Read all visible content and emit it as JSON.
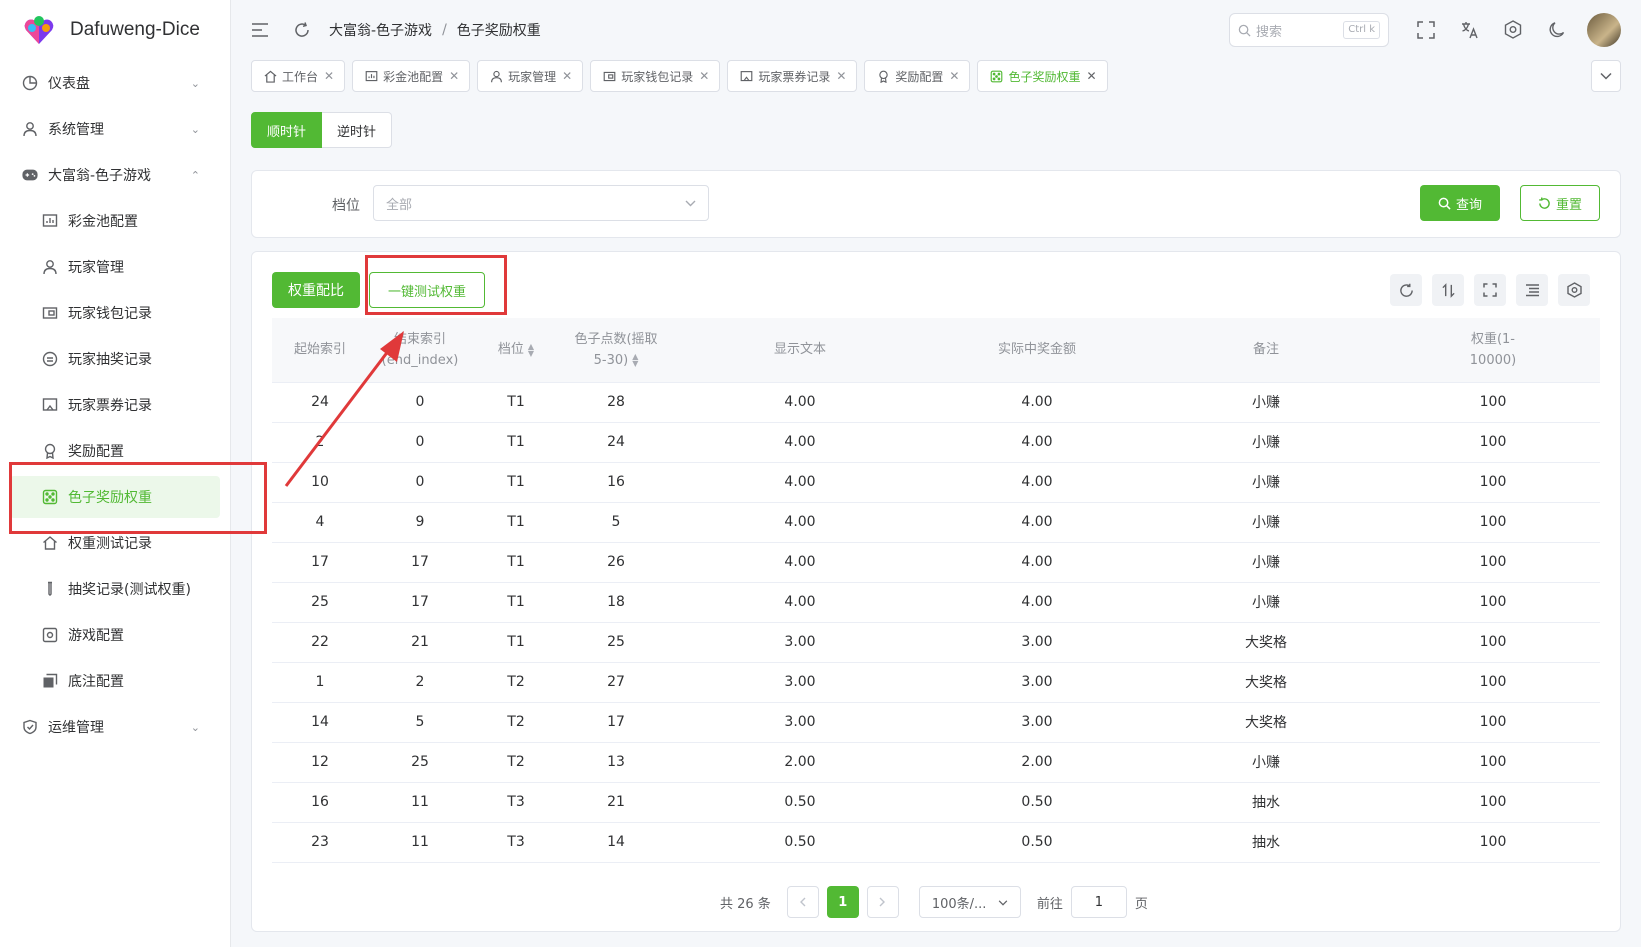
{
  "app": {
    "title": "Dafuweng-Dice"
  },
  "sidebar": {
    "items": [
      {
        "label": "仪表盘",
        "icon": "dashboard-icon"
      },
      {
        "label": "系统管理",
        "icon": "user-icon"
      },
      {
        "label": "大富翁-色子游戏",
        "icon": "gamepad-icon"
      },
      {
        "label": "运维管理",
        "icon": "shield-check-icon"
      }
    ],
    "sub_items": [
      {
        "label": "彩金池配置",
        "icon": "chart-board-icon"
      },
      {
        "label": "玩家管理",
        "icon": "user-icon"
      },
      {
        "label": "玩家钱包记录",
        "icon": "wallet-icon"
      },
      {
        "label": "玩家抽奖记录",
        "icon": "lottery-icon"
      },
      {
        "label": "玩家票券记录",
        "icon": "ticket-icon"
      },
      {
        "label": "奖励配置",
        "icon": "medal-icon"
      },
      {
        "label": "色子奖励权重",
        "icon": "dice-icon"
      },
      {
        "label": "权重测试记录",
        "icon": "house-icon"
      },
      {
        "label": "抽奖记录(测试权重)",
        "icon": "test-tube-icon"
      },
      {
        "label": "游戏配置",
        "icon": "game-config-icon"
      },
      {
        "label": "底注配置",
        "icon": "copy-icon"
      }
    ]
  },
  "header": {
    "breadcrumb": [
      "大富翁-色子游戏",
      "色子奖励权重"
    ],
    "search_placeholder": "搜索",
    "search_shortcut": "Ctrl k"
  },
  "tabs": [
    {
      "label": "工作台",
      "icon": "home-icon"
    },
    {
      "label": "彩金池配置",
      "icon": "chart-board-icon"
    },
    {
      "label": "玩家管理",
      "icon": "user-icon"
    },
    {
      "label": "玩家钱包记录",
      "icon": "wallet-icon"
    },
    {
      "label": "玩家票券记录",
      "icon": "ticket-icon"
    },
    {
      "label": "奖励配置",
      "icon": "medal-icon"
    },
    {
      "label": "色子奖励权重",
      "icon": "dice-icon"
    }
  ],
  "direction": {
    "clockwise": "顺时针",
    "counterclockwise": "逆时针"
  },
  "filter": {
    "label": "档位",
    "placeholder": "全部",
    "query_label": "查询",
    "reset_label": "重置"
  },
  "toolbar": {
    "ratio_label": "权重配比",
    "test_label": "一键测试权重"
  },
  "table": {
    "headers": {
      "start": "起始索引",
      "end_1": "结束索引",
      "end_2": "(end_index)",
      "tier": "档位",
      "dice_1": "色子点数(摇取",
      "dice_2": "5-30)",
      "text": "显示文本",
      "amount": "实际中奖金额",
      "remark": "备注",
      "weight_1": "权重(1-",
      "weight_2": "10000)"
    },
    "rows": [
      [
        "24",
        "0",
        "T1",
        "28",
        "4.00",
        "4.00",
        "小赚",
        "100"
      ],
      [
        "2",
        "0",
        "T1",
        "24",
        "4.00",
        "4.00",
        "小赚",
        "100"
      ],
      [
        "10",
        "0",
        "T1",
        "16",
        "4.00",
        "4.00",
        "小赚",
        "100"
      ],
      [
        "4",
        "9",
        "T1",
        "5",
        "4.00",
        "4.00",
        "小赚",
        "100"
      ],
      [
        "17",
        "17",
        "T1",
        "26",
        "4.00",
        "4.00",
        "小赚",
        "100"
      ],
      [
        "25",
        "17",
        "T1",
        "18",
        "4.00",
        "4.00",
        "小赚",
        "100"
      ],
      [
        "22",
        "21",
        "T1",
        "25",
        "3.00",
        "3.00",
        "大奖格",
        "100"
      ],
      [
        "1",
        "2",
        "T2",
        "27",
        "3.00",
        "3.00",
        "大奖格",
        "100"
      ],
      [
        "14",
        "5",
        "T2",
        "17",
        "3.00",
        "3.00",
        "大奖格",
        "100"
      ],
      [
        "12",
        "25",
        "T2",
        "13",
        "2.00",
        "2.00",
        "小赚",
        "100"
      ],
      [
        "16",
        "11",
        "T3",
        "21",
        "0.50",
        "0.50",
        "抽水",
        "100"
      ],
      [
        "23",
        "11",
        "T3",
        "14",
        "0.50",
        "0.50",
        "抽水",
        "100"
      ]
    ]
  },
  "pagination": {
    "total": "共 26 条",
    "current": "1",
    "page_size": "100条/...",
    "goto_label": "前往",
    "goto_value": "1",
    "page_unit": "页"
  },
  "colors": {
    "accent": "#52b934",
    "annotation": "#e0393a"
  }
}
